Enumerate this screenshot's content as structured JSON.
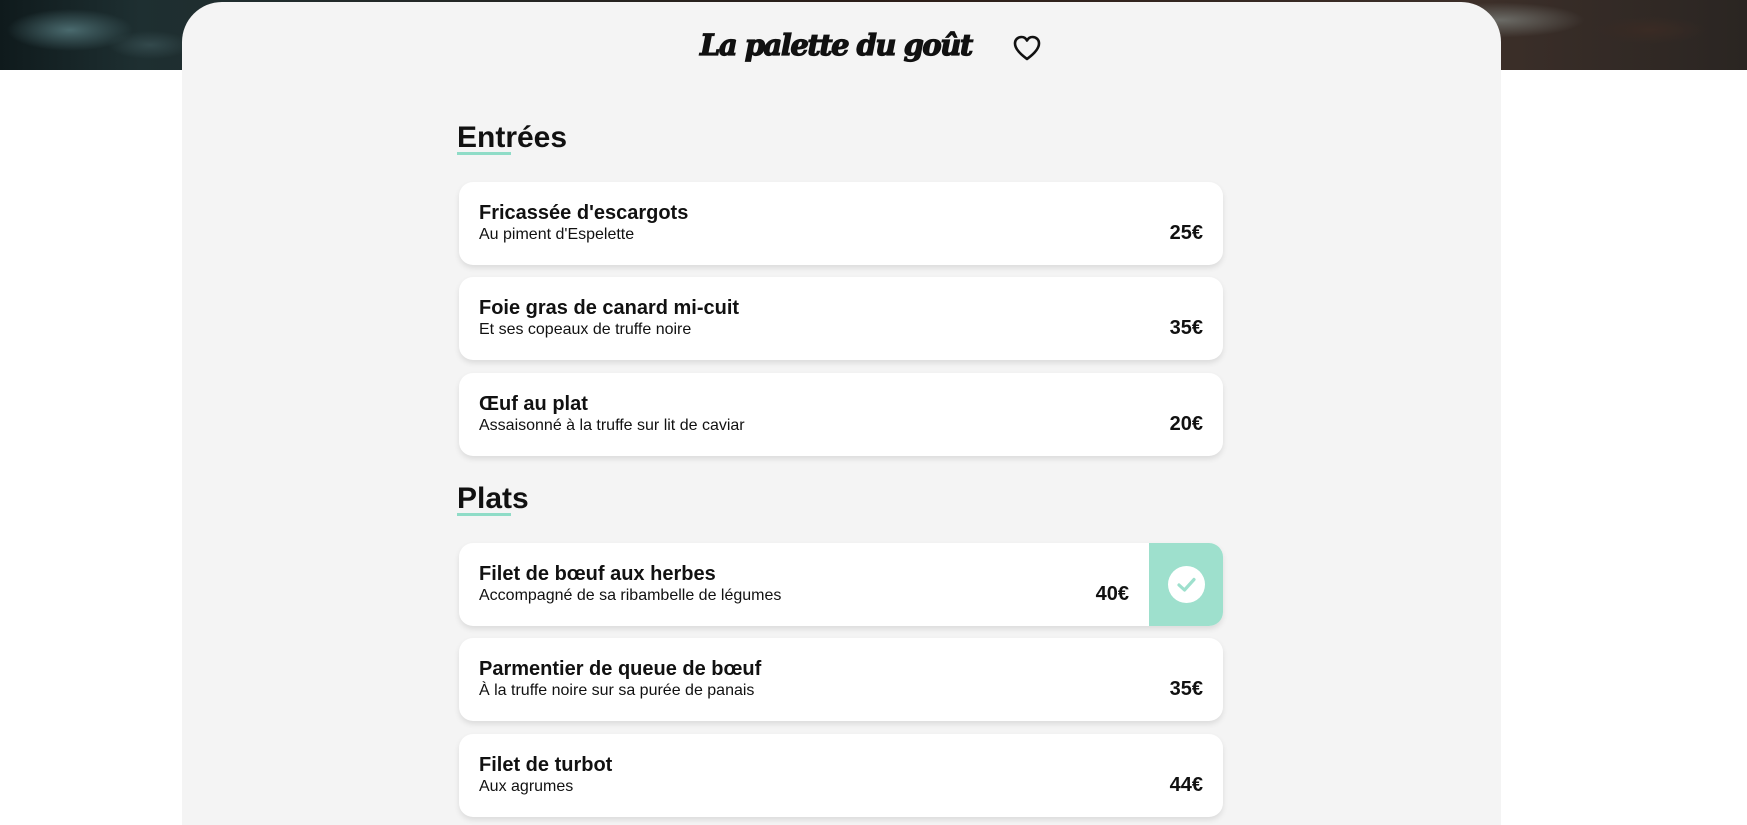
{
  "header": {
    "title": "La palette du goût",
    "favorite_icon": "heart-icon"
  },
  "sections": [
    {
      "title": "Entrées",
      "items": [
        {
          "name": "Fricassée d'escargots",
          "description": "Au piment d'Espelette",
          "price": "25€",
          "selected": false
        },
        {
          "name": "Foie gras de canard mi-cuit",
          "description": "Et ses copeaux de truffe noire",
          "price": "35€",
          "selected": false
        },
        {
          "name": "Œuf au plat",
          "description": "Assaisonné à la truffe sur lit de caviar",
          "price": "20€",
          "selected": false
        }
      ]
    },
    {
      "title": "Plats",
      "items": [
        {
          "name": "Filet de bœuf aux herbes",
          "description": "Accompagné de sa ribambelle de légumes",
          "price": "40€",
          "selected": true
        },
        {
          "name": "Parmentier de queue de bœuf",
          "description": "À la truffe noire sur sa purée de panais",
          "price": "35€",
          "selected": false
        },
        {
          "name": "Filet de turbot",
          "description": "Aux agrumes",
          "price": "44€",
          "selected": false
        }
      ]
    }
  ],
  "colors": {
    "accent": "#9ee0cd",
    "underline": "#8fdcc7",
    "card_background": "#f4f4f4"
  }
}
